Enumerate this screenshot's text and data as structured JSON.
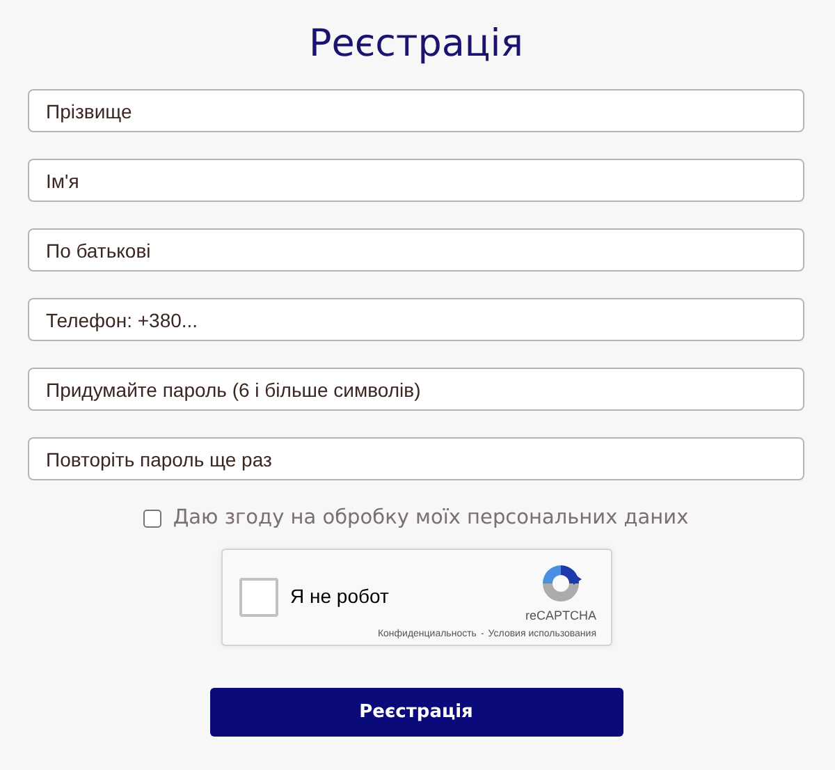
{
  "title": "Реєстрація",
  "fields": [
    {
      "placeholder": "Прізвище"
    },
    {
      "placeholder": "Ім'я"
    },
    {
      "placeholder": "По батькові"
    },
    {
      "placeholder": "Телефон: +380..."
    },
    {
      "placeholder": "Придумайте пароль (6 і більше символів)"
    },
    {
      "placeholder": "Повторіть пароль ще раз"
    }
  ],
  "consent": {
    "label": "Даю згоду на обробку моїх персональних даних",
    "checked": false
  },
  "captcha": {
    "label": "Я не робот",
    "checked": false,
    "brand": "reCAPTCHA",
    "privacy": "Конфиденциальность",
    "separator": "-",
    "terms": "Условия использования"
  },
  "submit": "Реєстрація"
}
